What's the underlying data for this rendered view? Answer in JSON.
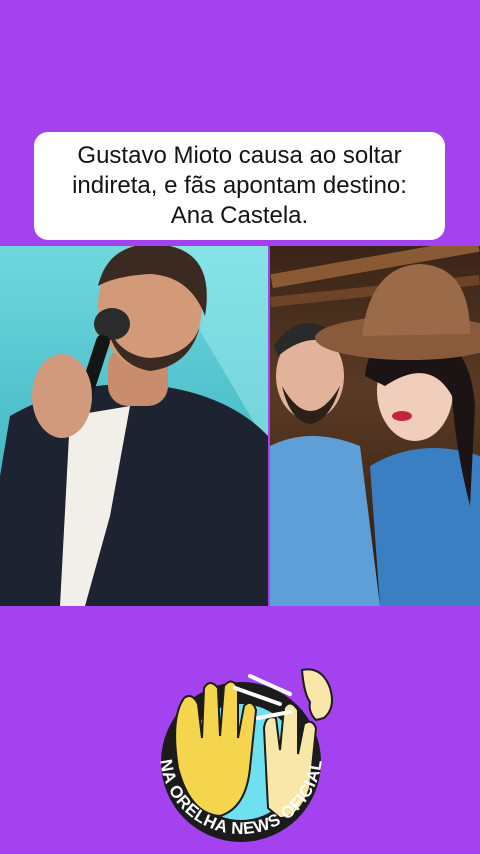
{
  "headline": {
    "text": "Gustavo Mioto causa ao soltar\nindireta, e fãs apontam destino:\nAna Castela."
  },
  "photos": {
    "left_alt": "singer-with-microphone",
    "right_alt": "couple-selfie-cowboy-hat"
  },
  "logo": {
    "text": "NA ORELHA NEWS OFICIAL"
  },
  "colors": {
    "background": "#a442f0",
    "card": "#ffffff",
    "text": "#141414",
    "logo_ring": "#1b1b1b",
    "logo_fill": "#6fe0f0"
  }
}
